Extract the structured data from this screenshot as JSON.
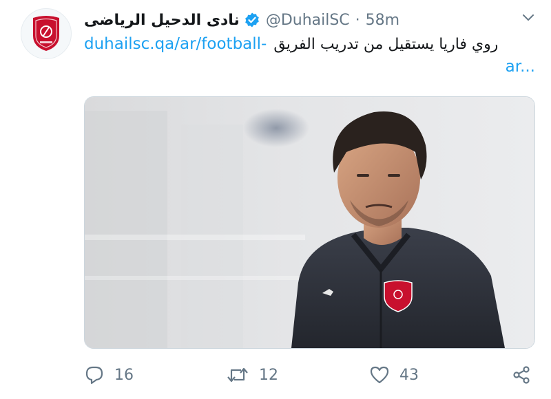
{
  "tweet": {
    "display_name": "نادى الدحيل الرياضى",
    "handle": "@DuhailSC",
    "separator": "·",
    "time": "58m",
    "text_arabic": "روي فاريا يستقيل من تدريب الفريق",
    "link_line1": "duhailsc.qa/ar/football-",
    "link_line2": "ar...",
    "avatar_logo": "duhail-sc-crest",
    "media_description_icon": "coach-photo"
  },
  "actions": {
    "reply_count": "16",
    "retweet_count": "12",
    "like_count": "43"
  },
  "colors": {
    "link": "#1da1f2",
    "muted": "#657786",
    "verified": "#1da1f2",
    "brand_red": "#c8102e"
  }
}
